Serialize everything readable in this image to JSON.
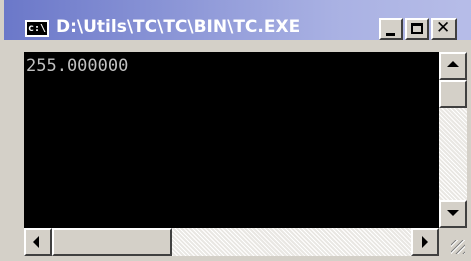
{
  "window": {
    "title": "D:\\Utils\\TC\\TC\\BIN\\TC.EXE",
    "icon": "console-icon",
    "icon_text": "c:\\",
    "buttons": {
      "minimize_icon": "minimize-icon",
      "maximize_icon": "maximize-icon",
      "close_icon": "close-icon",
      "close_glyph": "✕"
    }
  },
  "console": {
    "output": "255.000000",
    "background": "#000000",
    "foreground": "#c0c0c0"
  },
  "scrollbars": {
    "vertical": {
      "up_icon": "arrow-up-icon",
      "down_icon": "arrow-down-icon"
    },
    "horizontal": {
      "left_icon": "arrow-left-icon",
      "right_icon": "arrow-right-icon"
    }
  },
  "colors": {
    "titlebar_start": "#6b78c9",
    "titlebar_end": "#b7bde8",
    "frame": "#d4d0c8"
  }
}
